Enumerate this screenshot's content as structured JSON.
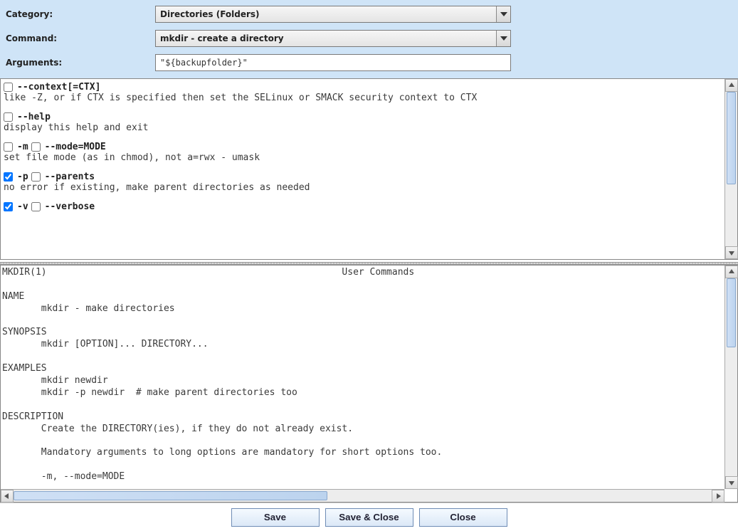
{
  "form": {
    "category_label": "Category:",
    "category_value": "Directories (Folders)",
    "command_label": "Command:",
    "command_value": "mkdir - create a directory",
    "arguments_label": "Arguments:",
    "arguments_value": "\"${backupfolder}\""
  },
  "options": [
    {
      "checks": [
        {
          "checked": false
        }
      ],
      "flag": "--context[=CTX]",
      "desc": "like -Z, or if CTX is specified then set the SELinux or SMACK security context to CTX"
    },
    {
      "checks": [
        {
          "checked": false
        }
      ],
      "flag": "--help",
      "desc": "display this help and exit"
    },
    {
      "checks": [
        {
          "checked": false
        },
        {
          "checked": false
        }
      ],
      "flag": "-m",
      "flag2": "--mode=MODE",
      "desc": "set file mode (as in chmod), not a=rwx - umask"
    },
    {
      "checks": [
        {
          "checked": true
        },
        {
          "checked": false
        }
      ],
      "flag": "-p",
      "flag2": "--parents",
      "desc": "no error if existing, make parent directories as needed"
    },
    {
      "checks": [
        {
          "checked": true
        },
        {
          "checked": false
        }
      ],
      "flag": "-v",
      "flag2": "--verbose",
      "desc": ""
    }
  ],
  "manpage": "MKDIR(1)                                                     User Commands\n\nNAME\n       mkdir - make directories\n\nSYNOPSIS\n       mkdir [OPTION]... DIRECTORY...\n\nEXAMPLES\n       mkdir newdir\n       mkdir -p newdir  # make parent directories too\n\nDESCRIPTION\n       Create the DIRECTORY(ies), if they do not already exist.\n\n       Mandatory arguments to long options are mandatory for short options too.\n\n       -m, --mode=MODE",
  "buttons": {
    "save": "Save",
    "save_close": "Save & Close",
    "close": "Close"
  }
}
